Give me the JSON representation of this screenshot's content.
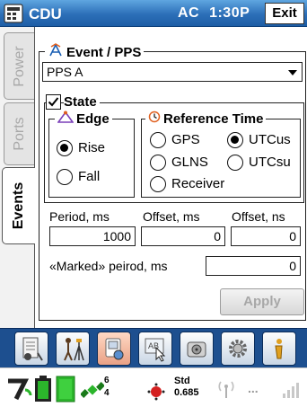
{
  "title_bar": {
    "icon": "pda-menu-icon",
    "title": "CDU",
    "power_source": "AC",
    "time": "1:30P",
    "exit_label": "Exit"
  },
  "tabs": [
    {
      "label": "Power",
      "active": false
    },
    {
      "label": "Ports",
      "active": false
    },
    {
      "label": "Events",
      "active": true
    }
  ],
  "event_pps": {
    "group_label": "Event / PPS",
    "selected": "PPS A"
  },
  "state": {
    "label": "State",
    "checked": true
  },
  "edge": {
    "group_label": "Edge",
    "options": [
      {
        "label": "Rise",
        "selected": true
      },
      {
        "label": "Fall",
        "selected": false
      }
    ]
  },
  "reference_time": {
    "group_label": "Reference Time",
    "options": [
      {
        "label": "GPS",
        "selected": false
      },
      {
        "label": "UTCus",
        "selected": true
      },
      {
        "label": "GLNS",
        "selected": false
      },
      {
        "label": "UTCsu",
        "selected": false
      },
      {
        "label": "Receiver",
        "selected": false
      }
    ]
  },
  "fields": {
    "period_label": "Period, ms",
    "period_value": "1000",
    "offset_ms_label": "Offset, ms",
    "offset_ms_value": "0",
    "offset_ns_label": "Offset, ns",
    "offset_ns_value": "0",
    "marked_period_label": "«Marked» peirod, ms",
    "marked_period_value": "0"
  },
  "apply_label": "Apply",
  "toolbar": {
    "buttons": [
      {
        "icon": "receiver-notebook-icon",
        "active": false
      },
      {
        "icon": "surveyor-tripod-icon",
        "active": false
      },
      {
        "icon": "cdu-settings-icon",
        "active": true
      },
      {
        "icon": "map-cursor-icon",
        "active": false
      },
      {
        "icon": "data-disk-icon",
        "active": false
      },
      {
        "icon": "gear-icon",
        "active": false
      },
      {
        "icon": "info-icon",
        "active": false
      }
    ]
  },
  "status_bar": {
    "satellites_top": "6",
    "satellites_bottom": "4",
    "solution_label": "Std",
    "solution_value": "0.685",
    "more_label": "..."
  },
  "colors": {
    "title_bar": "#2c6fb8",
    "toolbar": "#1d4f8f",
    "battery_green": "#2bb52b",
    "disabled_text": "#a7a7a7"
  }
}
